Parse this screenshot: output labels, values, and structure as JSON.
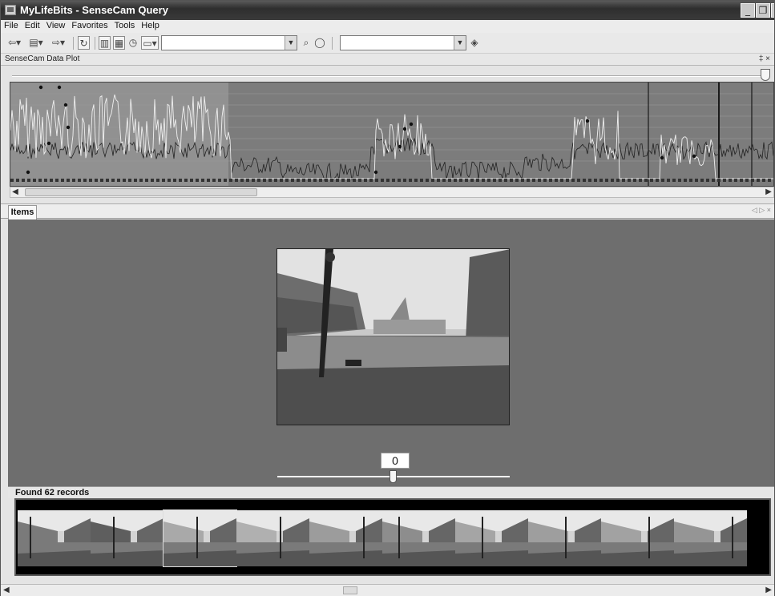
{
  "window": {
    "title": "MyLifeBits - SenseCam Query",
    "controls": [
      "minimize",
      "restore",
      "close"
    ]
  },
  "menu": [
    "File",
    "Edit",
    "View",
    "Favorites",
    "Tools",
    "Help"
  ],
  "toolbar": {
    "address_value": "",
    "search_value": "",
    "icons": [
      "back-icon",
      "folder-icon",
      "forward-icon",
      "refresh-icon",
      "view-grid-icon",
      "view-list-icon",
      "clock-icon",
      "view-options-icon",
      "search-icon",
      "search-clear-icon",
      "go-icon"
    ]
  },
  "plot_panel": {
    "title": "SenseCam Data Plot",
    "pin_label": "‡ ×"
  },
  "items_panel": {
    "tab_label": "Items",
    "nav_label": "◁ ▷ ×",
    "image_index": "0",
    "found_label": "Found 62 records"
  },
  "colors": {
    "plot_bg": "#7c7c7c",
    "plot_bg_selected": "#919191",
    "viewer_bg": "#6e6e6e",
    "title_bar": "#3a3a3a"
  }
}
